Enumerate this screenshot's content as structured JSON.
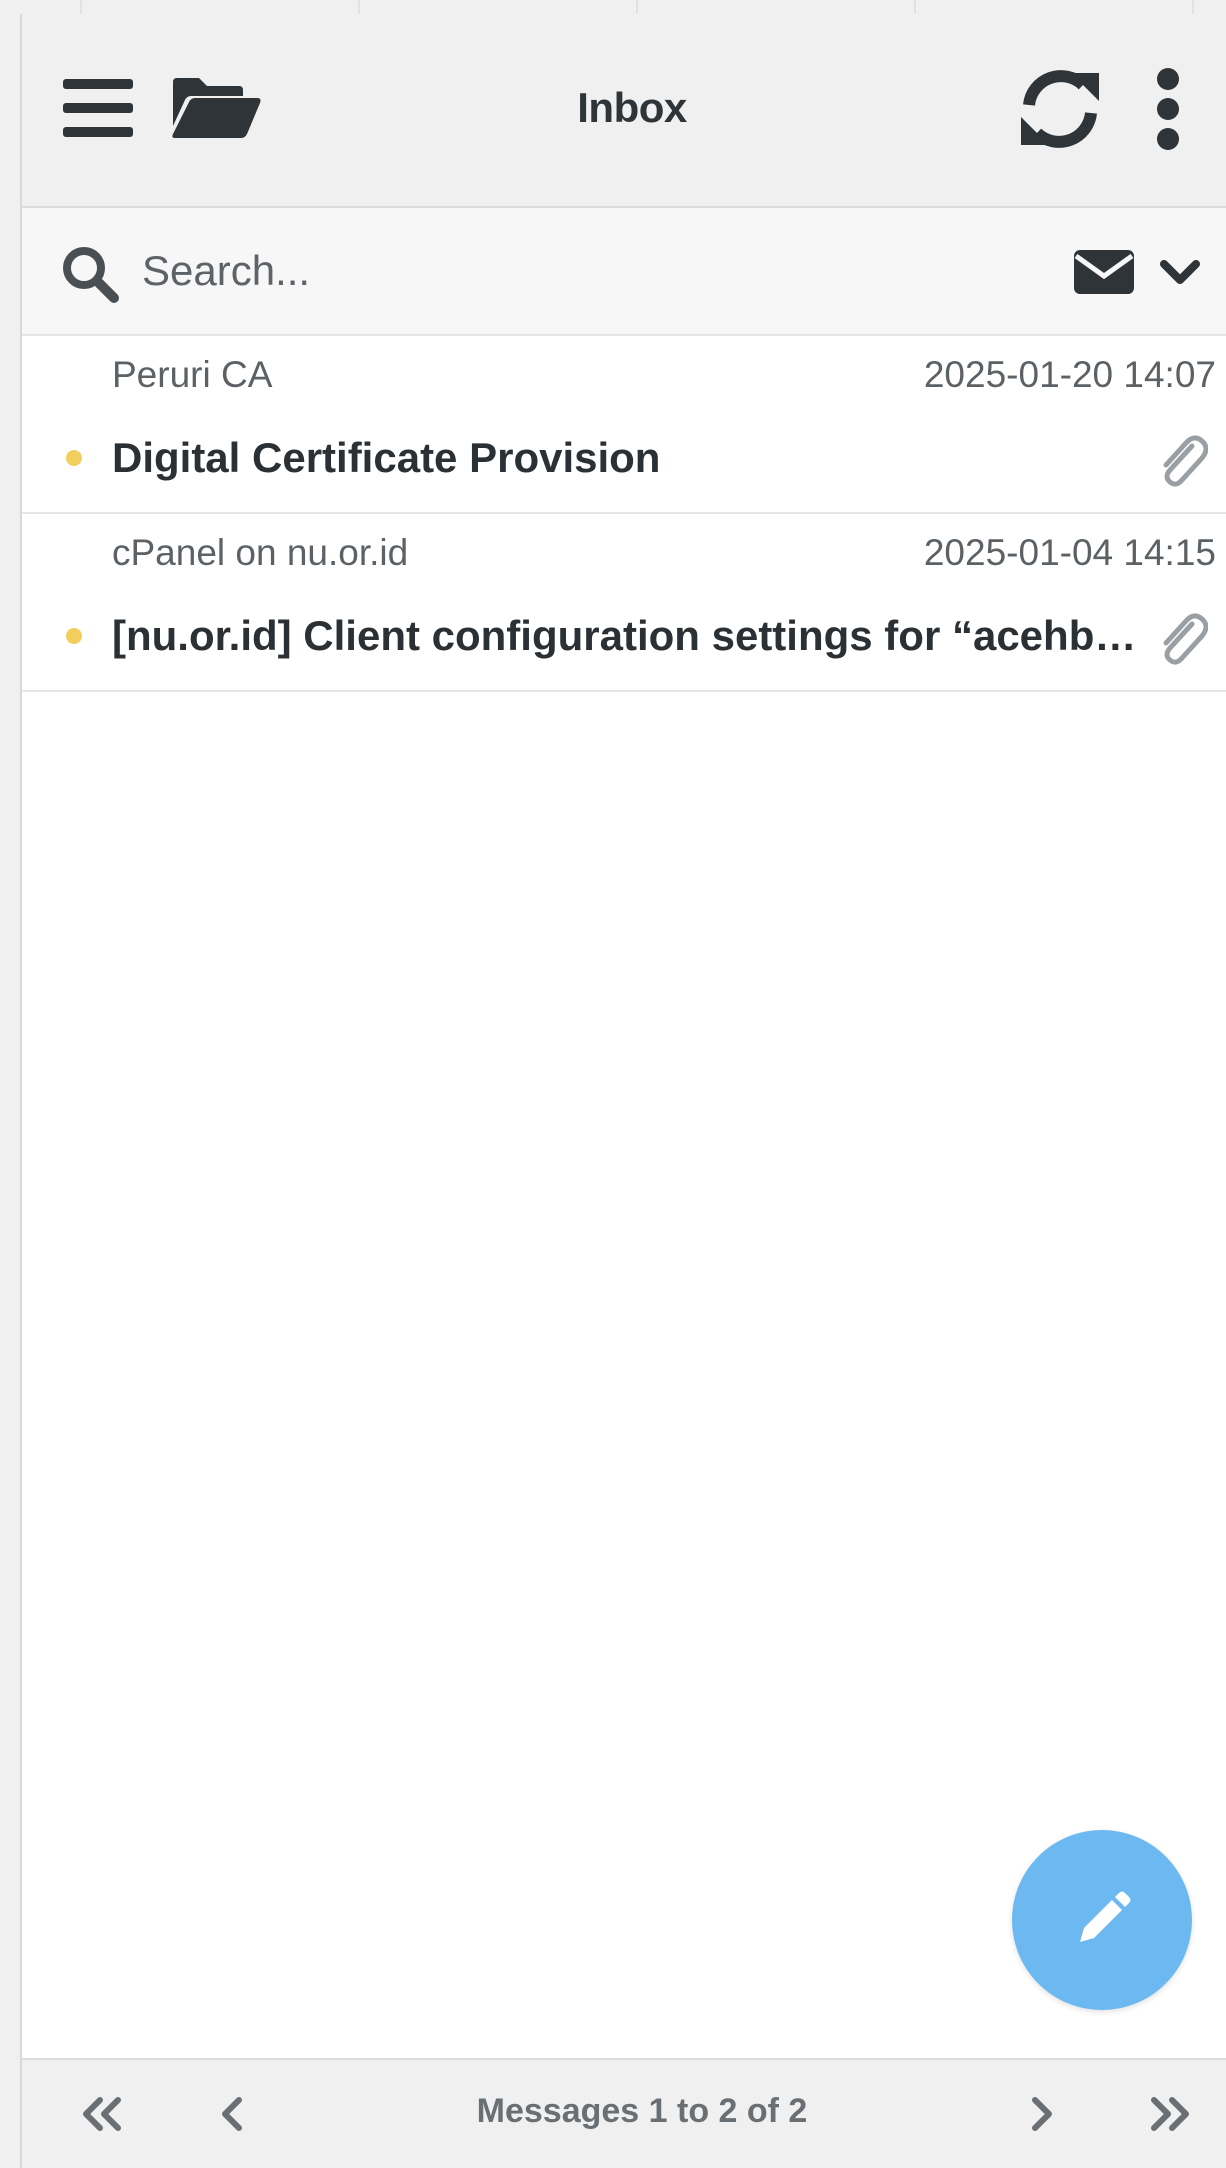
{
  "header": {
    "title": "Inbox",
    "menu_icon": "hamburger-menu-icon",
    "folder_icon": "folder-open-icon",
    "refresh_icon": "refresh-icon",
    "more_icon": "vertical-dots-icon"
  },
  "search": {
    "placeholder": "Search...",
    "value": "",
    "filter_icon": "envelope-icon",
    "options_icon": "chevron-down-icon"
  },
  "messages": [
    {
      "from": "Peruri CA",
      "date": "2025-01-20 14:07",
      "subject": "Digital Certificate Provision",
      "unread": true,
      "has_attachment": true
    },
    {
      "from": "cPanel on nu.or.id",
      "date": "2025-01-04 14:15",
      "subject": "[nu.or.id] Client configuration settings for “acehb…",
      "unread": true,
      "has_attachment": true
    }
  ],
  "compose": {
    "icon": "pencil-icon"
  },
  "pagination": {
    "info": "Messages 1 to 2 of 2",
    "first_icon": "double-chevron-left-icon",
    "prev_icon": "chevron-left-icon",
    "next_icon": "chevron-right-icon",
    "last_icon": "double-chevron-right-icon"
  },
  "colors": {
    "unread_dot": "#f2ce5c",
    "fab": "#6cb8f0",
    "header_bg": "#f0f0f0",
    "text_dark": "#2b3035",
    "text_muted": "#5c6166"
  }
}
